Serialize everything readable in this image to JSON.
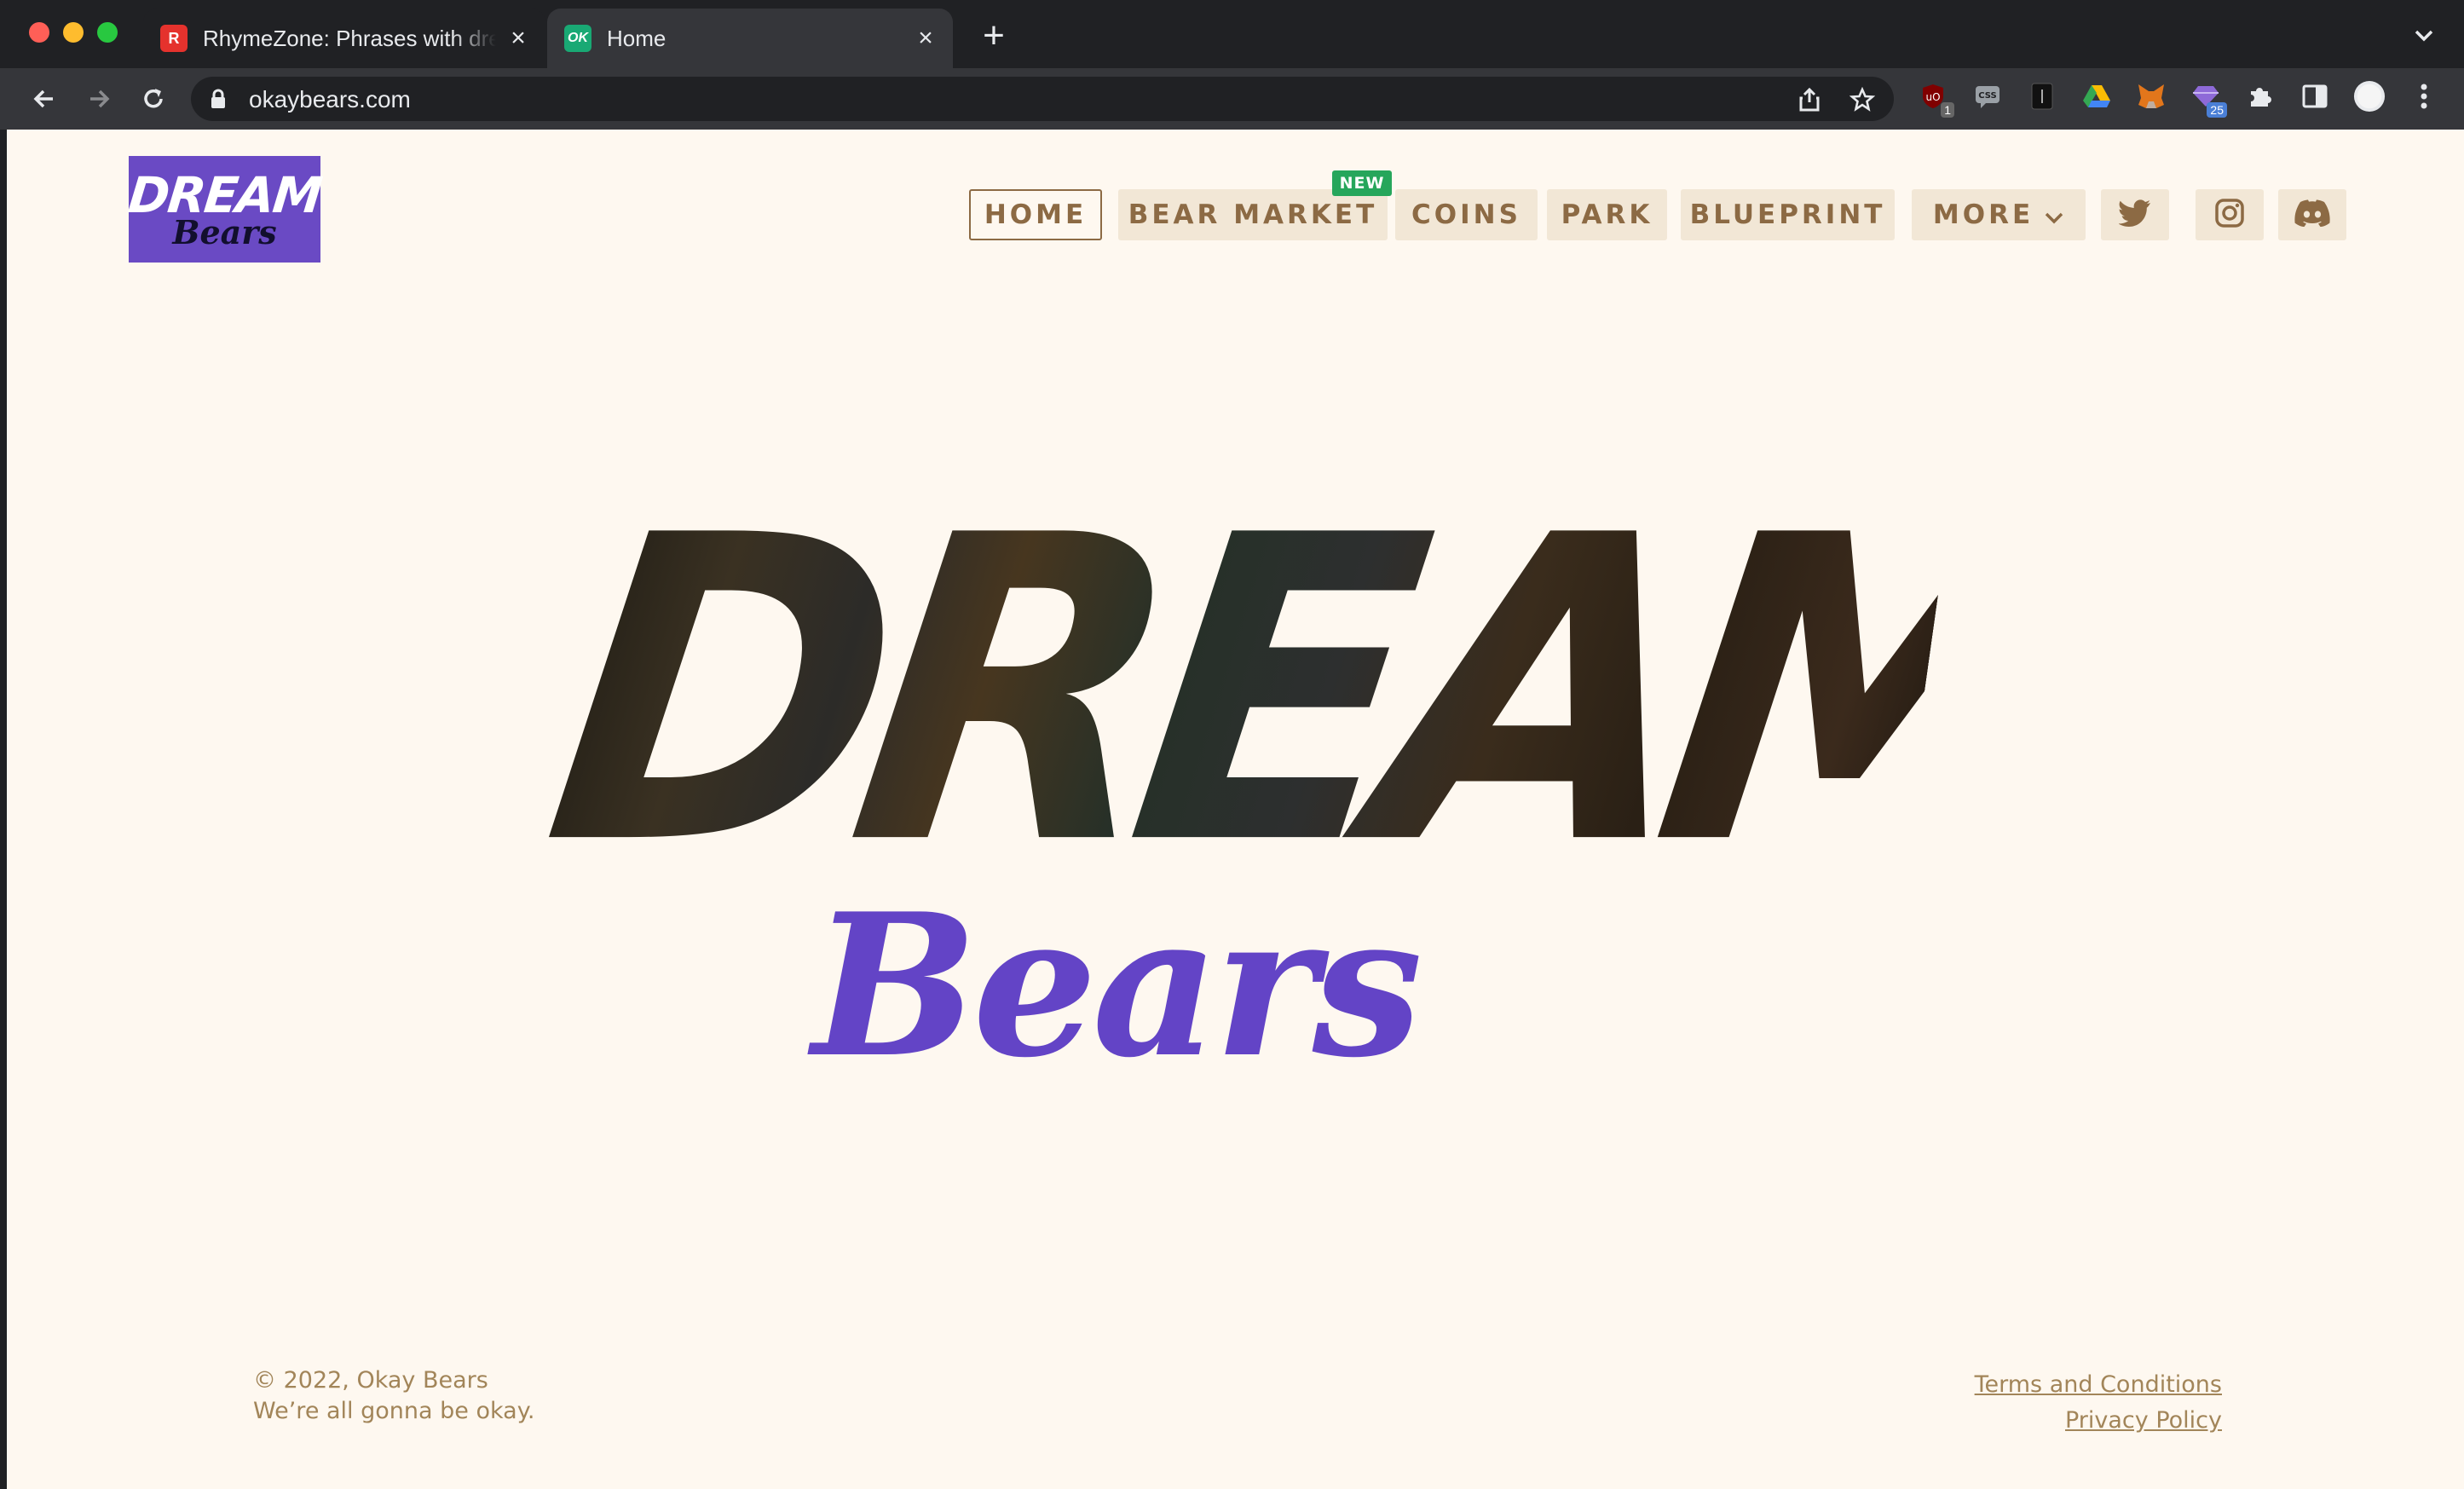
{
  "browser": {
    "tabs": [
      {
        "title": "RhymeZone: Phrases with dream",
        "favicon": "rhymezone-favicon",
        "active": false
      },
      {
        "title": "Home",
        "favicon": "okaybears-favicon",
        "active": true
      }
    ],
    "url": "okaybears.com",
    "extension_badges": {
      "ublock": "1",
      "gem": "25"
    }
  },
  "site": {
    "logo": {
      "line1": "DREAM",
      "line2": "Bears"
    },
    "nav": {
      "home": "HOME",
      "bear_market": "BEAR MARKET",
      "bear_market_badge": "NEW",
      "coins": "COINS",
      "park": "PARK",
      "blueprint": "BLUEPRINT",
      "more": "MORE"
    },
    "social": [
      "twitter-icon",
      "instagram-icon",
      "discord-icon"
    ],
    "hero": {
      "title": "DREAM",
      "subtitle": "Bears"
    },
    "footer": {
      "copyright": "© 2022, Okay Bears",
      "tagline": "We’re all gonna be okay.",
      "terms": "Terms and Conditions",
      "privacy": "Privacy Policy"
    }
  },
  "colors": {
    "page_bg": "#fef8f0",
    "nav_bg": "#f2e7d6",
    "nav_text": "#8c6a44",
    "brand_purple": "#6a4ac4",
    "new_badge": "#26a65b",
    "footer_text": "#a28559"
  }
}
